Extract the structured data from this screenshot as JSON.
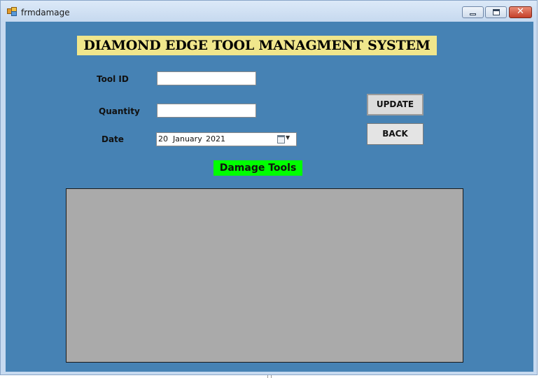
{
  "window": {
    "title": "frmdamage",
    "minimize_icon": "minimize-icon",
    "maximize_icon": "restore-icon",
    "close_icon": "close-icon",
    "close_glyph": "✕"
  },
  "form": {
    "heading": "DIAMOND EDGE TOOL MANAGMENT SYSTEM",
    "tool_id_label": "Tool ID",
    "tool_id_value": "",
    "quantity_label": "Quantity",
    "quantity_value": "",
    "date_label": "Date",
    "date": {
      "day": "20",
      "month": "January",
      "year": "2021"
    },
    "update_button": "UPDATE",
    "back_button": "BACK",
    "grid_title": "Damage Tools"
  },
  "colors": {
    "client_background": "#4682b4",
    "heading_background": "#f0e68c",
    "grid_title_background": "#00ff00",
    "grid_background": "#aaaaaa"
  }
}
